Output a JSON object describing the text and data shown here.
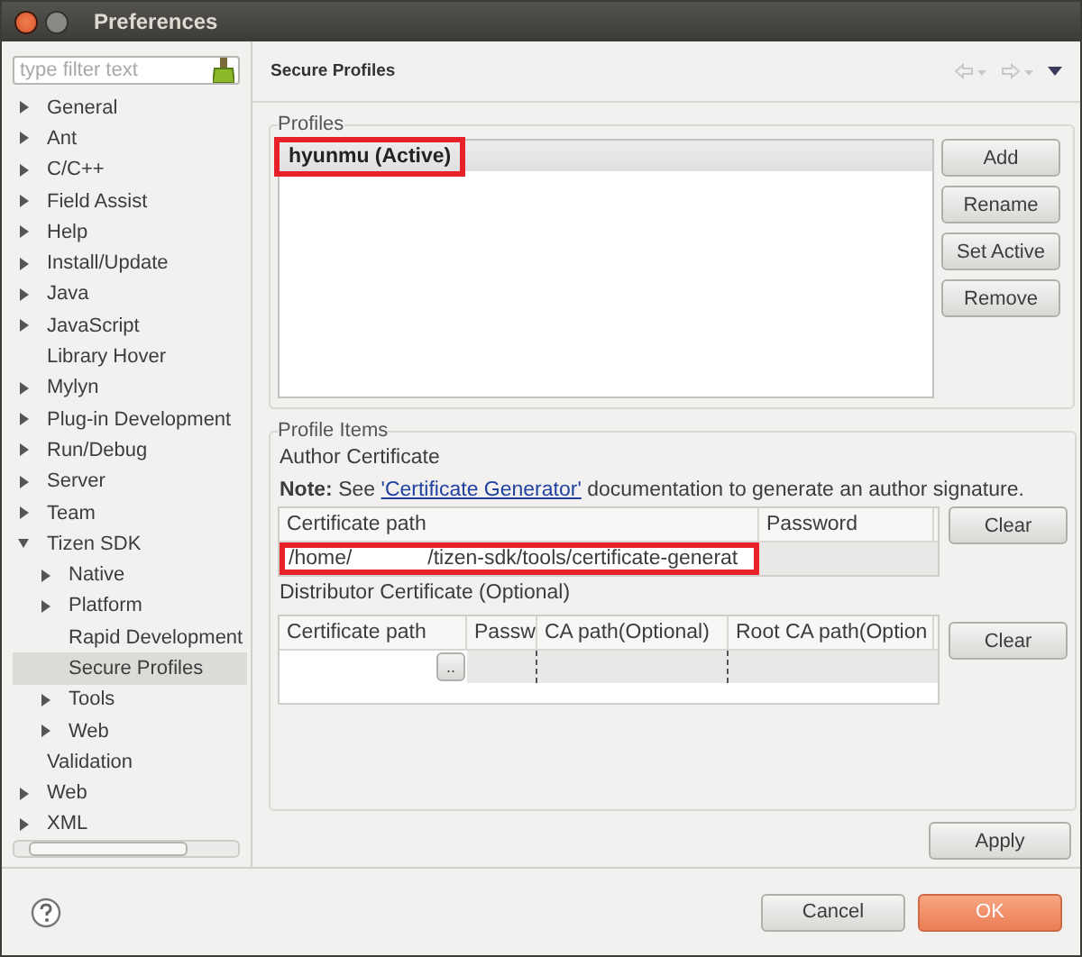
{
  "window": {
    "title": "Preferences"
  },
  "filter": {
    "placeholder": "type filter text"
  },
  "tree": [
    {
      "label": "General",
      "expandable": true,
      "expanded": false,
      "selected": false
    },
    {
      "label": "Ant",
      "expandable": true,
      "expanded": false,
      "selected": false
    },
    {
      "label": "C/C++",
      "expandable": true,
      "expanded": false,
      "selected": false
    },
    {
      "label": "Field Assist",
      "expandable": true,
      "expanded": false,
      "selected": false
    },
    {
      "label": "Help",
      "expandable": true,
      "expanded": false,
      "selected": false
    },
    {
      "label": "Install/Update",
      "expandable": true,
      "expanded": false,
      "selected": false
    },
    {
      "label": "Java",
      "expandable": true,
      "expanded": false,
      "selected": false
    },
    {
      "label": "JavaScript",
      "expandable": true,
      "expanded": false,
      "selected": false
    },
    {
      "label": "Library Hover",
      "expandable": false,
      "selected": false
    },
    {
      "label": "Mylyn",
      "expandable": true,
      "expanded": false,
      "selected": false
    },
    {
      "label": "Plug-in Development",
      "expandable": true,
      "expanded": false,
      "selected": false
    },
    {
      "label": "Run/Debug",
      "expandable": true,
      "expanded": false,
      "selected": false
    },
    {
      "label": "Server",
      "expandable": true,
      "expanded": false,
      "selected": false
    },
    {
      "label": "Team",
      "expandable": true,
      "expanded": false,
      "selected": false
    },
    {
      "label": "Tizen SDK",
      "expandable": true,
      "expanded": true,
      "selected": false,
      "children": [
        {
          "label": "Native",
          "expandable": true,
          "expanded": false,
          "selected": false
        },
        {
          "label": "Platform",
          "expandable": true,
          "expanded": false,
          "selected": false
        },
        {
          "label": "Rapid Development",
          "expandable": false,
          "selected": false
        },
        {
          "label": "Secure Profiles",
          "expandable": false,
          "selected": true
        },
        {
          "label": "Tools",
          "expandable": true,
          "expanded": false,
          "selected": false
        },
        {
          "label": "Web",
          "expandable": true,
          "expanded": false,
          "selected": false
        }
      ]
    },
    {
      "label": "Validation",
      "expandable": false,
      "selected": false
    },
    {
      "label": "Web",
      "expandable": true,
      "expanded": false,
      "selected": false
    },
    {
      "label": "XML",
      "expandable": true,
      "expanded": false,
      "selected": false
    }
  ],
  "page": {
    "title": "Secure Profiles"
  },
  "profiles": {
    "legend": "Profiles",
    "items": [
      {
        "label": "hyunmu (Active)",
        "selected": true,
        "highlighted": true
      }
    ],
    "buttons": [
      "Add",
      "Rename",
      "Set Active",
      "Remove"
    ]
  },
  "profile_items": {
    "legend": "Profile Items",
    "author": {
      "heading": "Author Certificate",
      "note_label": "Note:",
      "note_before": "See",
      "note_link": "'Certificate Generator'",
      "note_after": "documentation to generate an author signature.",
      "columns": [
        "Certificate path",
        "Password"
      ],
      "path_start": "/home/",
      "path_end": "/tizen-sdk/tools/certificate-generat",
      "path_highlighted": true,
      "button": "Clear"
    },
    "distributor": {
      "heading": "Distributor Certificate (Optional)",
      "columns": [
        "Certificate path",
        "Passw",
        "CA path(Optional)",
        "Root CA path(Option"
      ],
      "browse": "..",
      "button": "Clear"
    }
  },
  "apply": "Apply",
  "footer": {
    "cancel": "Cancel",
    "ok": "OK"
  }
}
